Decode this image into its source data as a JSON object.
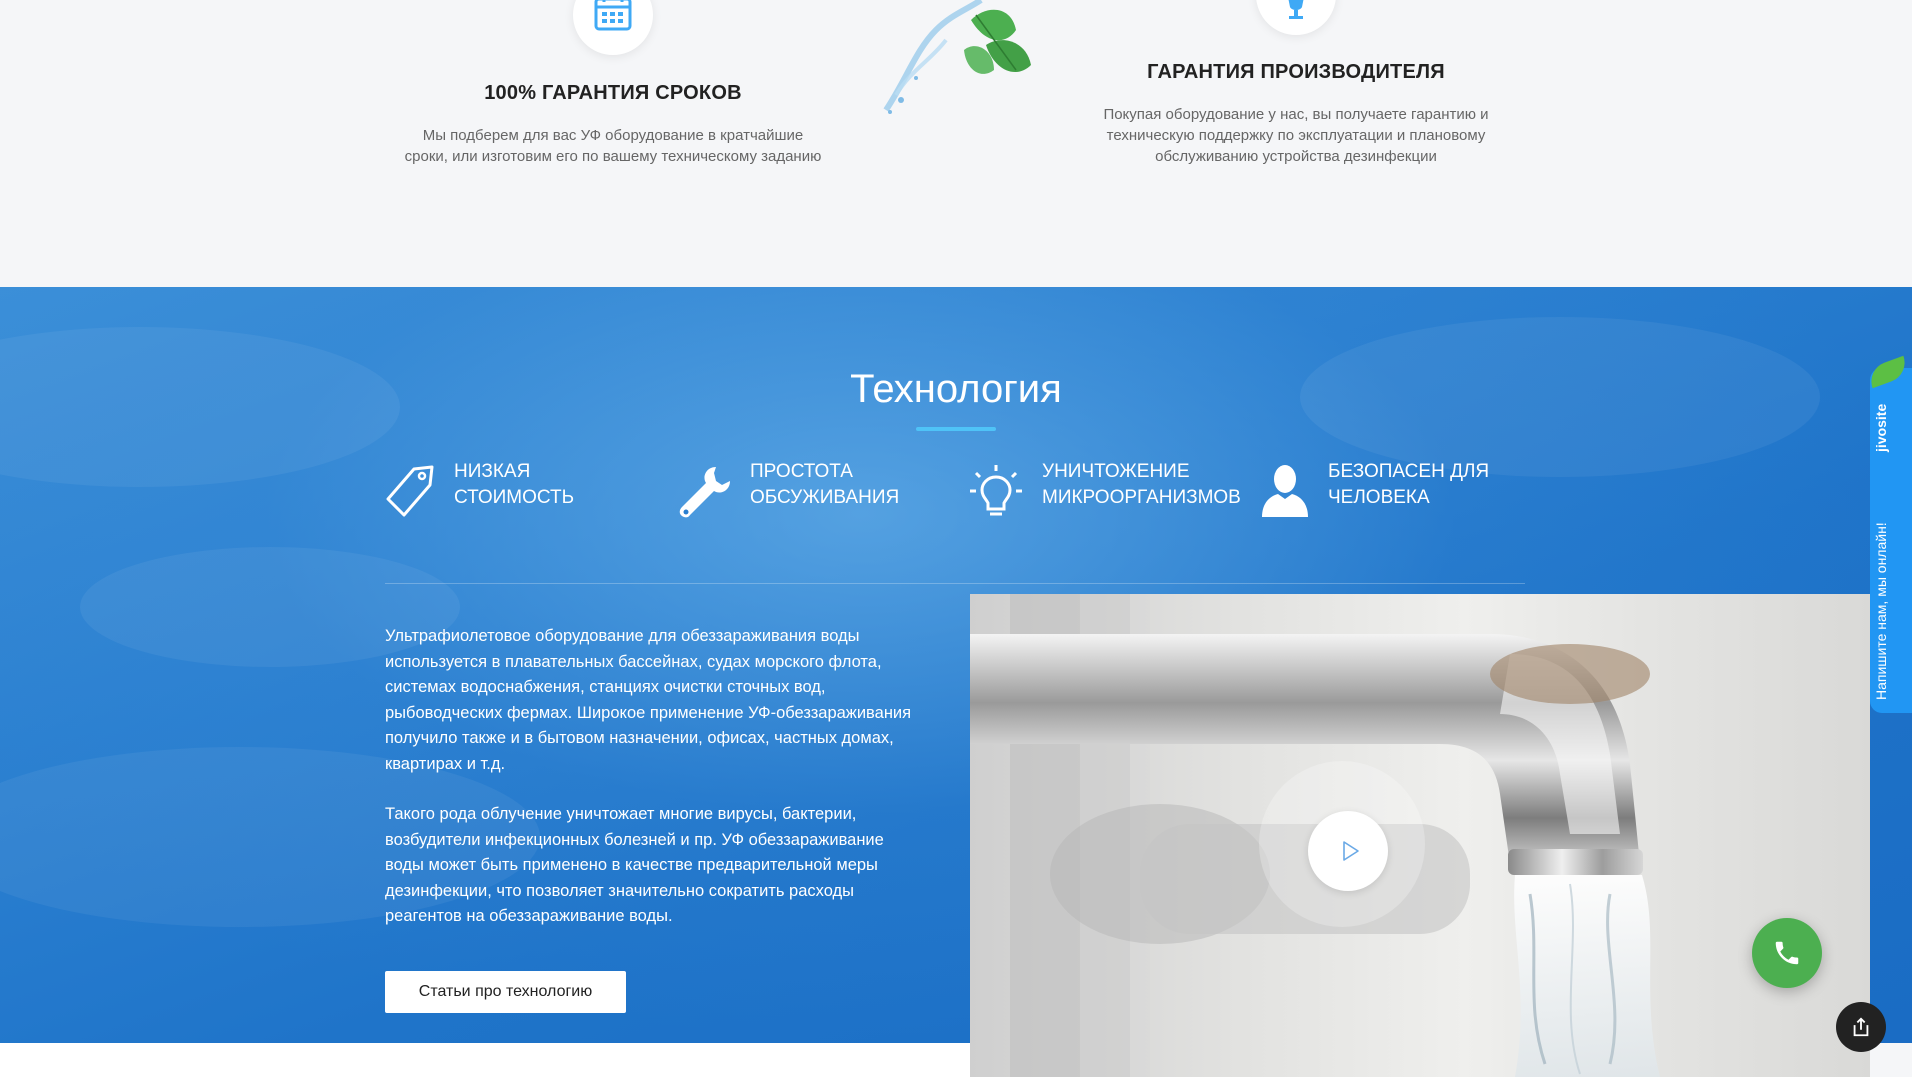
{
  "features": [
    {
      "title": "100% ГАРАНТИЯ СРОКОВ",
      "text_line1": "Мы подберем для вас УФ оборудование в кратчайшие",
      "text_line2": "сроки, или изготовим его по вашему техническому заданию",
      "icon": "calendar-icon"
    },
    {
      "title": "ГАРАНТИЯ ПРОИЗВОДИТЕЛЯ",
      "text_line1": "Покупая оборудование у нас, вы получаете гарантию и",
      "text_line2": "техническую поддержку по эксплуатации и плановому",
      "text_line3": "обслуживанию устройства дезинфекции",
      "icon": "award-icon"
    }
  ],
  "tech": {
    "title": "Технология",
    "items": [
      {
        "line1": "НИЗКАЯ",
        "line2": "СТОИМОСТЬ",
        "icon": "price-tag-icon"
      },
      {
        "line1": "ПРОСТОТА",
        "line2": "ОБСУЖИВАНИЯ",
        "icon": "wrench-icon"
      },
      {
        "line1": "УНИЧТОЖЕНИЕ",
        "line2": "МИКРООРГАНИЗМОВ",
        "icon": "lightbulb-icon"
      },
      {
        "line1": "БЕЗОПАСЕН ДЛЯ",
        "line2": "ЧЕЛОВЕКА",
        "icon": "person-icon"
      }
    ],
    "paragraph1": [
      "Ультрафиолетовое оборудование для обеззараживания воды",
      "используется в плавательных бассейнах, судах морского флота,",
      "системах водоснабжения, станциях очистки сточных вод,",
      "рыбоводческих фермах. Широкое применение УФ-обеззараживания",
      "получило также и в бытовом назначении, офисах, частных домах,",
      "квартирах и т.д."
    ],
    "paragraph2": [
      "Такого рода облучение уничтожает многие вирусы, бактерии,",
      "возбудители инфекционных болезней и пр. УФ обеззараживание",
      "воды может быть применено в качестве предварительной меры",
      "дезинфекции, что позволяет значительно сократить расходы",
      "реагентов на обеззараживание воды."
    ],
    "button_label": "Статьи про технологию"
  },
  "chat": {
    "brand": "jivosite",
    "text": "Напишите нам, мы онлайн!"
  },
  "colors": {
    "accent": "#4fc3f7",
    "section_blue": "#2a7fd0",
    "chat_blue": "#2196f3",
    "phone_green": "#4caf50"
  }
}
